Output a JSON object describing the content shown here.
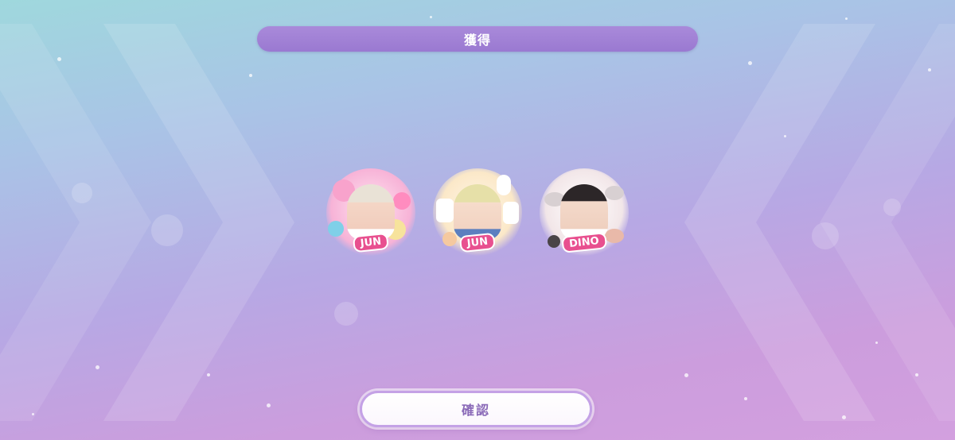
{
  "header": {
    "title": "獲得"
  },
  "rewards": [
    {
      "name": "JUN",
      "theme": "candy",
      "colors": {
        "primary": "#f7b3d7",
        "secondary": "#ffd6ea",
        "accent": "#e8508f"
      }
    },
    {
      "name": "JUN",
      "theme": "2023 bunny",
      "colors": {
        "primary": "#fbe8c8",
        "secondary": "#cfe7f5",
        "accent": "#e8508f"
      }
    },
    {
      "name": "DINO",
      "theme": "ribbon lace",
      "colors": {
        "primary": "#f2e6e8",
        "secondary": "#e9b9a9",
        "accent": "#e8508f"
      }
    }
  ],
  "footer": {
    "confirm_label": "確認"
  },
  "colors": {
    "title_bar": "#9a79d1",
    "confirm_text": "#8a6ab8",
    "confirm_border": "#c4a2e6"
  }
}
